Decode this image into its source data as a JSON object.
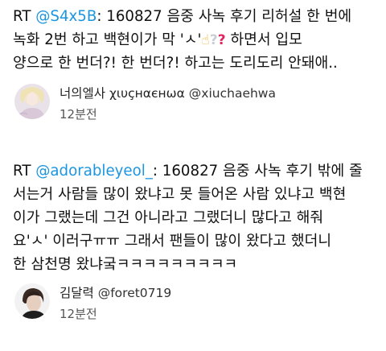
{
  "tweets": [
    {
      "text_lines": [
        {
          "rt": "RT ",
          "mention": "@S4x5B",
          "rest": ": 160827 음중 사녹 후기 리허설 한 번에"
        },
        {
          "text": "녹화 2번 하고 백현이가 막 'ㅅ'"
        },
        {
          "text": " 하면서 입모"
        },
        {
          "text": "양으로 한 번더?! 한 번더?! 하고는 도리도리 안돼애.."
        }
      ],
      "emojis": [
        "hand-pointing-up-icon",
        "grey-question-mark-icon",
        "red-question-mark-icon"
      ],
      "author": {
        "display_name": "너의엘사 χιυçнαєнωα",
        "handle": "@xiuchaehwa",
        "time": "12분전"
      }
    },
    {
      "text_lines": [
        {
          "rt": "RT ",
          "mention": "@adorableyeol_",
          "rest": ": 160827 음중 사녹 후기 밖에 줄"
        },
        {
          "text": "서는거 사람들 많이 왔냐고 못 들어온 사람 있냐고 백현"
        },
        {
          "text": "이가 그랬는데 그건 아니라고 그랬더니 많다고 해줘"
        },
        {
          "text": "요'ㅅ' 이러구ㅠㅠ 그래서 팬들이 많이 왔다고 했더니"
        },
        {
          "text": "한 삼천명 왔냐궄ㅋㅋㅋㅋㅋㅋㅋㅋㅋ"
        }
      ],
      "author": {
        "display_name": "김달력",
        "handle": "@foret0719",
        "time": "12분전"
      }
    }
  ],
  "colors": {
    "mention": "#1b95e0",
    "text": "#111111",
    "meta": "#555555"
  }
}
